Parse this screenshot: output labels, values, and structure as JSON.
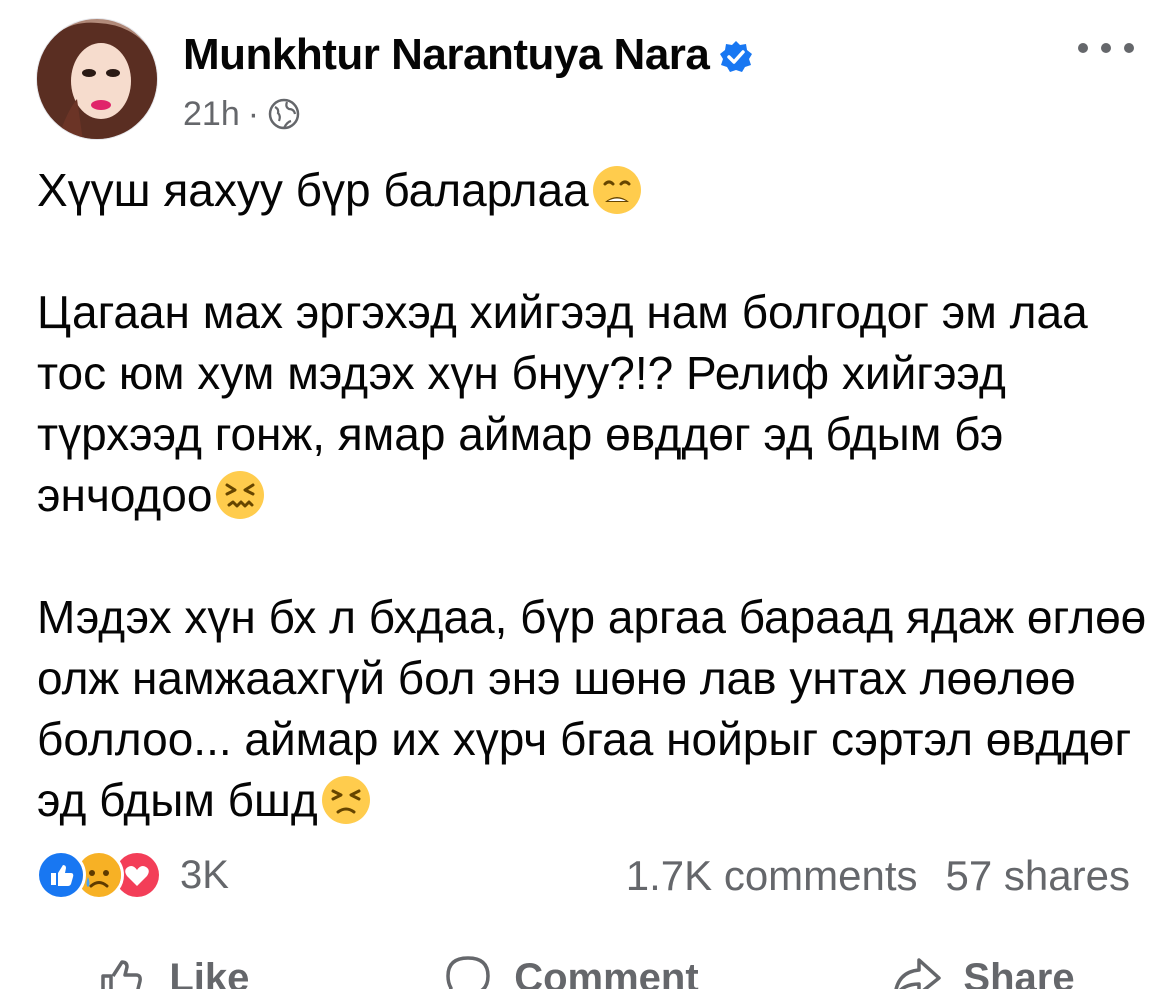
{
  "header": {
    "author_name": "Munkhtur Narantuya Nara",
    "timestamp": "21h",
    "separator": "·",
    "audience_icon": "globe-icon",
    "verified_icon": "verified-badge-icon",
    "more_icon": "more-options-icon"
  },
  "post": {
    "line1": "Хүүш яахуу бүр баларлаа",
    "para2": "Цагаан мах эргэхэд хийгээд нам болгодог эм лаа тос юм хум мэдэх хүн бнуу?!? Релиф хийгээд түрхээд гонж, ямар аймар өвддөг эд бдым бэ энчодоо",
    "para3": "Мэдэх хүн бх л бхдаа, бүр аргаа бараад ядаж өглөө олж намжаахгүй бол энэ шөнө лав унтах лөөлөө боллоо... аймар их хүрч бгаа нойрыг сэртэл өвддөг эд бдым бшд"
  },
  "reactions": {
    "icons": [
      "like-reaction-icon",
      "sad-reaction-icon",
      "love-reaction-icon"
    ],
    "count": "3K"
  },
  "stats": {
    "comments": "1.7K comments",
    "shares": "57 shares"
  },
  "actions": {
    "like": "Like",
    "comment": "Comment",
    "share": "Share"
  },
  "colors": {
    "text": "#050505",
    "secondary": "#65676b",
    "facebook_blue": "#1877f2",
    "love_red": "#f33e58",
    "sad_yellow": "#f7b125"
  }
}
